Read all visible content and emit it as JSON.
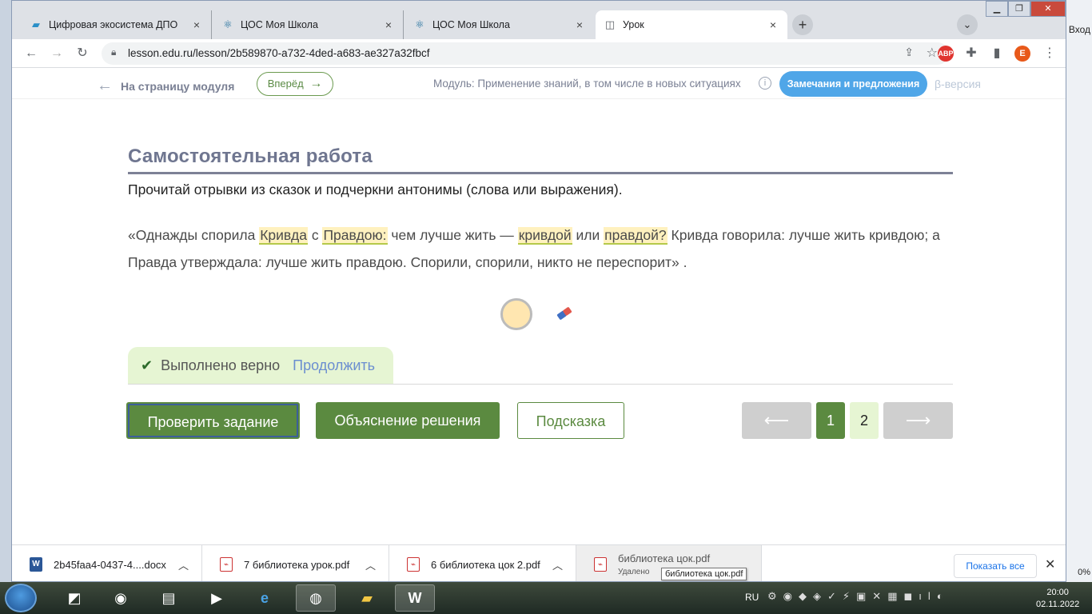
{
  "browser": {
    "tabs": [
      {
        "title": "Цифровая экосистема ДПО",
        "favicon": "dpo-icon",
        "active": false
      },
      {
        "title": "ЦОС Моя Школа",
        "favicon": "react-atom-icon",
        "active": false
      },
      {
        "title": "ЦОС Моя Школа",
        "favicon": "react-atom-icon",
        "active": false
      },
      {
        "title": "Урок",
        "favicon": "lesson-icon",
        "active": true
      }
    ],
    "tab_close": "×",
    "new_tab": "+",
    "url": "lesson.edu.ru/lesson/2b589870-a732-4ded-a683-ae327a32fbcf",
    "profile_initial": "E",
    "extensions": {
      "abp": "ABP"
    }
  },
  "page": {
    "nav": {
      "back_label": "На страницу модуля",
      "forward_label": "Вперёд",
      "module_label": "Модуль: Применение знаний, в том числе в новых ситуациях",
      "feedback_label": "Замечания и предложения",
      "beta_label": "β-версия"
    },
    "section_title": "Самостоятельная работа",
    "instruction": "Прочитай отрывки из сказок и подчеркни антонимы (слова или выражения).",
    "passage": {
      "t1": "«Однажды спорила ",
      "h1": "Кривда",
      "t2": " с ",
      "h2": "Правдою:",
      "t3": " чем лучше жить — ",
      "h3": "кривдой",
      "t4": " или ",
      "h4": "правдой?",
      "t5": " Кривда говорила: лучше жить кривдою; а Правда утверждала: лучше жить правдою. Спорили, спорили, никто не переспорит» ."
    },
    "result": {
      "status": "Выполнено верно",
      "continue": "Продолжить"
    },
    "buttons": {
      "check": "Проверить задание",
      "explain": "Объяснение решения",
      "hint": "Подсказка"
    },
    "pager": {
      "prev": "⟵",
      "pages": [
        "1",
        "2"
      ],
      "current": "1",
      "next": "⟶"
    }
  },
  "downloads": {
    "items": [
      {
        "name": "2b45faa4-0437-4....docx",
        "type": "docx",
        "status": ""
      },
      {
        "name": "7 библиотека урок.pdf",
        "type": "pdf",
        "status": ""
      },
      {
        "name": "6 библиотека цок 2.pdf",
        "type": "pdf",
        "status": ""
      },
      {
        "name": "библиотека цок.pdf",
        "type": "pdf",
        "status": "Удалено"
      }
    ],
    "tooltip": "библиотека цок.pdf",
    "show_all": "Показать все"
  },
  "desktop": {
    "login_text": "Вход",
    "edge_pct": "0%"
  },
  "taskbar": {
    "lang": "RU",
    "time": "20:00",
    "date": "02.11.2022"
  },
  "colors": {
    "accent_green": "#5b8a40",
    "highlight": "#fff1bf",
    "feedback_blue": "#4fa6e8",
    "success_bg": "#e6f5d3"
  }
}
